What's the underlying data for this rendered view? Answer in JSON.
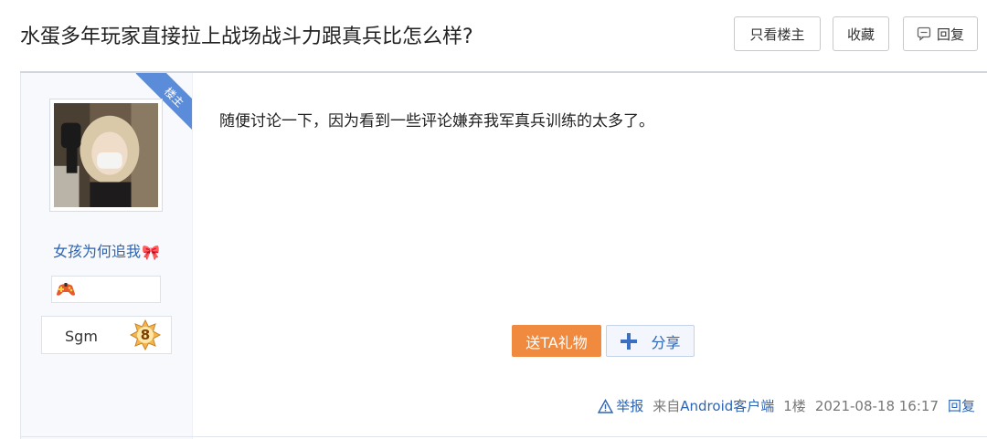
{
  "thread": {
    "title": "水蛋多年玩家直接拉上战场战斗力跟真兵比怎么样?"
  },
  "toolbar": {
    "only_op_label": "只看楼主",
    "favorite_label": "收藏",
    "reply_label": "回复",
    "reply_icon": "comment-icon"
  },
  "author": {
    "op_tag": "楼主",
    "username": "女孩为何追我",
    "username_emoji": "🎀",
    "badge_icon": "gamepad-icon",
    "level_name": "Sgm",
    "level": "8"
  },
  "post": {
    "content": "随便讨论一下，因为看到一些评论嫌弃我军真兵训练的太多了。",
    "gift_label": "送TA礼物",
    "share_label": "分享",
    "report_label": "举报",
    "source": "来自",
    "client": "Android客户端",
    "floor": "1楼",
    "timestamp": "2021-08-18 16:17",
    "reply_label": "回复"
  },
  "colors": {
    "link_blue": "#2d64b3",
    "gift_orange": "#ef8a3f",
    "op_tag_blue": "#5b8cda"
  }
}
